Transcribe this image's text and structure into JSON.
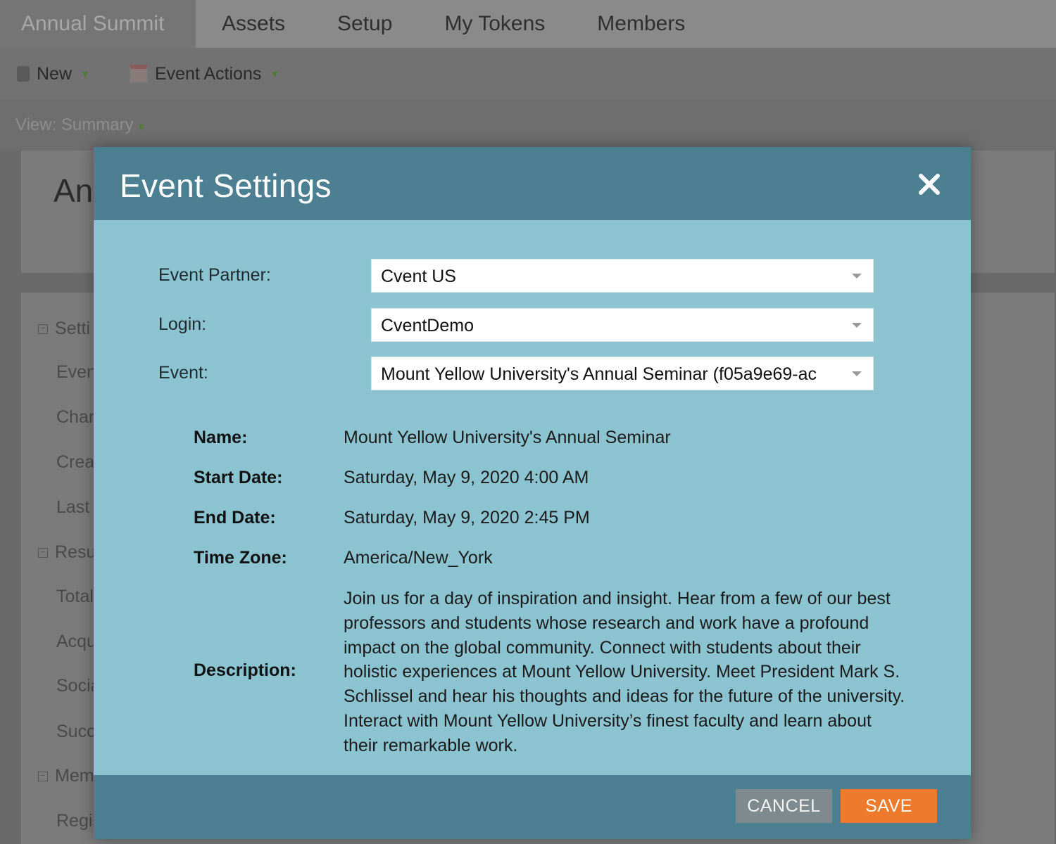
{
  "top_tabs": [
    {
      "label": "Annual Summit",
      "active": true
    },
    {
      "label": "Assets",
      "active": false
    },
    {
      "label": "Setup",
      "active": false
    },
    {
      "label": "My Tokens",
      "active": false
    },
    {
      "label": "Members",
      "active": false
    }
  ],
  "toolbar": {
    "new_label": "New",
    "event_actions_label": "Event Actions"
  },
  "view": {
    "label": "View: Summary"
  },
  "background": {
    "card_title": "An",
    "rows": [
      "Setti",
      "Even",
      "Char",
      "Crea",
      "Last",
      "Resu",
      "Total",
      "Acqu",
      "Socia",
      "Succ",
      "Mem",
      "Regis"
    ]
  },
  "modal": {
    "title": "Event Settings",
    "close_icon": "close-icon",
    "fields": {
      "event_partner": {
        "label": "Event Partner:",
        "value": "Cvent US"
      },
      "login": {
        "label": "Login:",
        "value": "CventDemo"
      },
      "event": {
        "label": "Event:",
        "value": "Mount Yellow University's Annual Seminar (f05a9e69-ac"
      }
    },
    "info": {
      "name_label": "Name:",
      "name_value": "Mount Yellow University's Annual Seminar",
      "start_label": "Start Date:",
      "start_value": "Saturday, May 9, 2020 4:00 AM",
      "end_label": "End Date:",
      "end_value": "Saturday, May 9, 2020 2:45 PM",
      "tz_label": "Time Zone:",
      "tz_value": "America/New_York",
      "desc_label": "Description:",
      "desc_value": "Join us for a day of inspiration and insight. Hear from a few of our best professors and students whose research and work have a profound impact on the global community. Connect with students about their holistic experiences at Mount Yellow University. Meet President Mark S. Schlissel and hear his thoughts and ideas for the future of the university. Interact with Mount Yellow University’s finest faculty and learn about their remarkable work."
    },
    "buttons": {
      "cancel": "CANCEL",
      "save": "SAVE"
    }
  },
  "colors": {
    "modal_header": "#4b7f91",
    "modal_body": "#8cc3d0",
    "save_button": "#ee7a2b",
    "cancel_button": "#7e8a8e"
  }
}
